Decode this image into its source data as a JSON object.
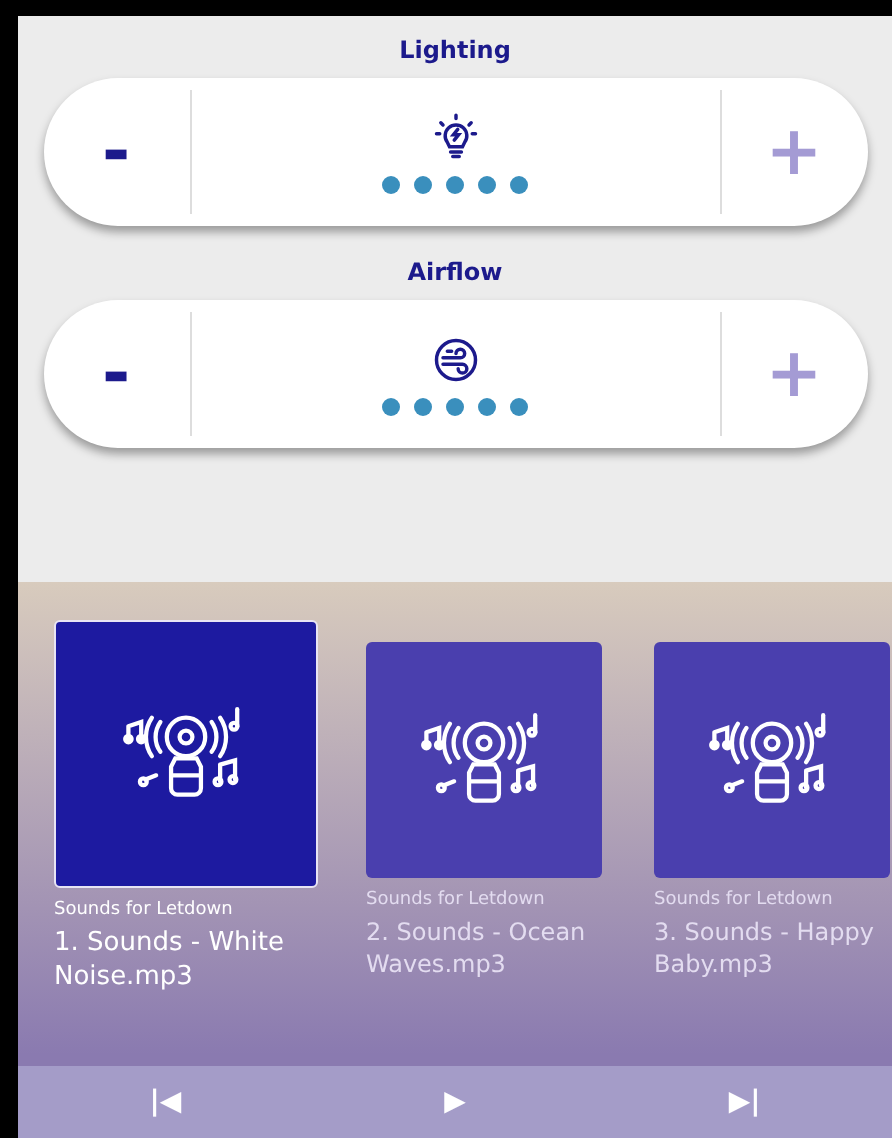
{
  "controls": [
    {
      "label": "Lighting",
      "kind": "light",
      "stars": 5,
      "minus": "-",
      "plus": "+"
    },
    {
      "label": "Airflow",
      "kind": "air",
      "stars": 5,
      "minus": "-",
      "plus": "+"
    }
  ],
  "tracks": [
    {
      "album": "Sounds for Letdown",
      "title": "1. Sounds - White Noise.mp3",
      "selected": true
    },
    {
      "album": "Sounds for Letdown",
      "title": "2. Sounds - Ocean Waves.mp3",
      "selected": false
    },
    {
      "album": "Sounds for Letdown",
      "title": "3. Sounds - Happy Baby.mp3",
      "selected": false
    }
  ],
  "player": {
    "previous": "|◀",
    "play": "▶",
    "next": "▶|"
  }
}
